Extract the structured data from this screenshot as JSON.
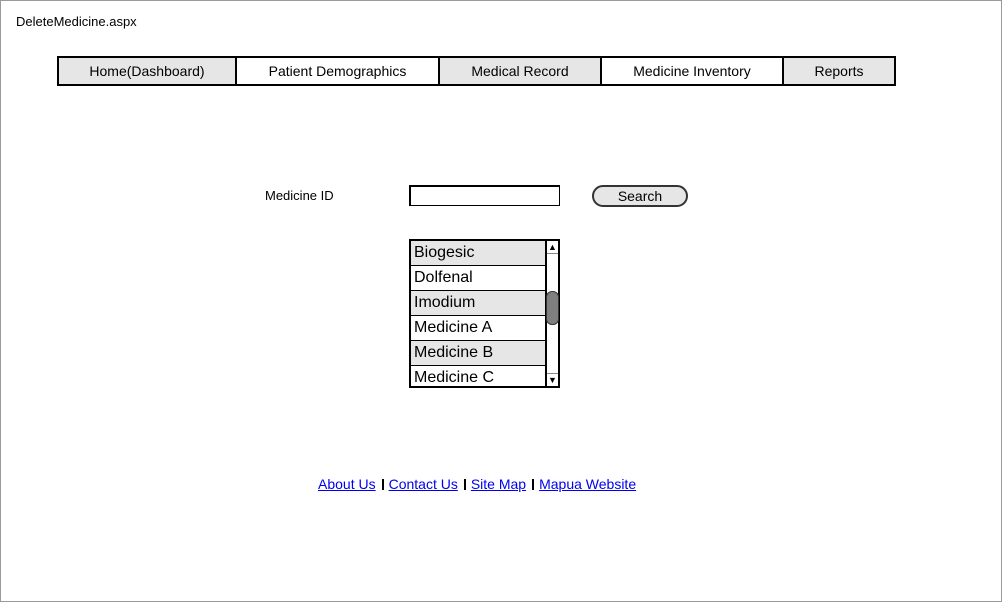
{
  "page": {
    "title": "DeleteMedicine.aspx"
  },
  "nav": {
    "tabs": [
      {
        "label": "Home(Dashboard)"
      },
      {
        "label": "Patient Demographics"
      },
      {
        "label": "Medical Record"
      },
      {
        "label": "Medicine Inventory"
      },
      {
        "label": "Reports"
      }
    ]
  },
  "search": {
    "label": "Medicine ID",
    "value": "",
    "button_label": "Search"
  },
  "medicine_list": {
    "items": [
      "Biogesic",
      "Dolfenal",
      "Imodium",
      "Medicine A",
      "Medicine B",
      "Medicine C"
    ],
    "scroll_up_glyph": "▲",
    "scroll_down_glyph": "▼"
  },
  "footer": {
    "links": [
      "About Us",
      "Contact Us",
      "Site Map",
      "Mapua Website"
    ]
  }
}
